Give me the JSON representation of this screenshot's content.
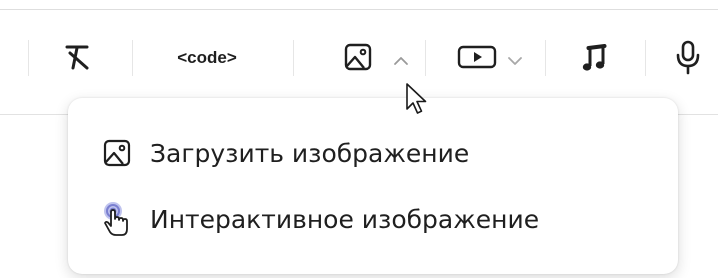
{
  "toolbar": {
    "buttons": [
      {
        "name": "clear-formatting",
        "icon": "clear-formatting-icon"
      },
      {
        "name": "code",
        "label": "<code>"
      },
      {
        "name": "image",
        "icon": "image-icon",
        "dropdown": "chevron-up-icon"
      },
      {
        "name": "video",
        "icon": "video-icon",
        "dropdown": "chevron-down-icon"
      },
      {
        "name": "audio",
        "icon": "music-note-icon"
      },
      {
        "name": "voice",
        "icon": "microphone-icon"
      }
    ]
  },
  "image_menu": {
    "items": [
      {
        "label": "Загрузить изображение",
        "icon": "image-icon"
      },
      {
        "label": "Интерактивное изображение",
        "icon": "interactive-hand-icon"
      }
    ]
  },
  "colors": {
    "icon": "#1f1f1f",
    "chevron": "#9a9a9a",
    "separator": "#e6e6e6",
    "accent": "#7a7fd0"
  }
}
